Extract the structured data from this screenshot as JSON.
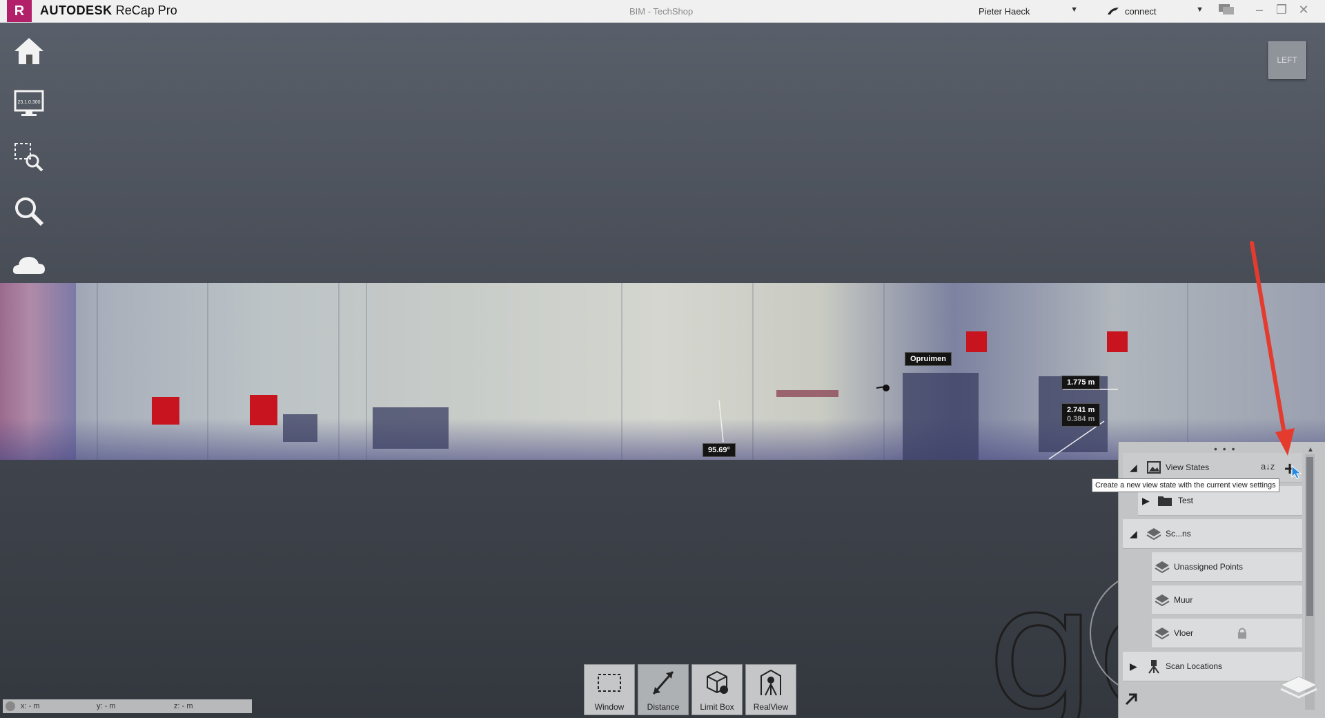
{
  "titlebar": {
    "app_brand": "AUTODESK",
    "app_product": "ReCap Pro",
    "logo_letter": "R",
    "document_title": "BIM - TechShop",
    "user_name": "Pieter Haeck",
    "connect_label": "connect"
  },
  "left_toolbar": {
    "items": [
      {
        "name": "home",
        "icon": "home-icon"
      },
      {
        "name": "display-settings",
        "icon": "monitor-icon",
        "badge": "23.1.0.300"
      },
      {
        "name": "zoom-window",
        "icon": "zoom-region-icon"
      },
      {
        "name": "search",
        "icon": "search-icon"
      },
      {
        "name": "cloud",
        "icon": "cloud-icon"
      }
    ]
  },
  "view_cube": {
    "face": "LEFT"
  },
  "annotations": {
    "tag_label": "Opruimen",
    "measure_1": "1.775 m",
    "measure_2": "2.741 m",
    "measure_2_sub": "0.384 m",
    "angle": "95.69°"
  },
  "bottom_tools": [
    {
      "label": "Window",
      "icon": "window-select-icon"
    },
    {
      "label": "Distance",
      "icon": "distance-icon"
    },
    {
      "label": "Limit Box",
      "icon": "limit-box-icon"
    },
    {
      "label": "RealView",
      "icon": "realview-icon"
    }
  ],
  "coordinates": {
    "x": "x:  - m",
    "y": "y:  - m",
    "z": "z:  - m"
  },
  "project_panel": {
    "view_states_label": "View States",
    "sort_label": "a↓z",
    "tooltip": "Create a new view state with the current view settings",
    "tree": [
      {
        "label": "Test",
        "type": "folder",
        "expanded": false
      },
      {
        "label": "Sc...ns",
        "type": "group",
        "expanded": true
      },
      {
        "label": "Unassigned Points",
        "type": "layer"
      },
      {
        "label": "Muur",
        "type": "layer"
      },
      {
        "label": "Vloer",
        "type": "layer"
      },
      {
        "label": "Scan Locations",
        "type": "scan-locations",
        "expanded": false
      }
    ]
  },
  "colors": {
    "brand": "#b3206a",
    "accent_arrow": "#e53b2f",
    "viewport_top": "#5b616c",
    "viewport_bottom": "#33373e"
  }
}
